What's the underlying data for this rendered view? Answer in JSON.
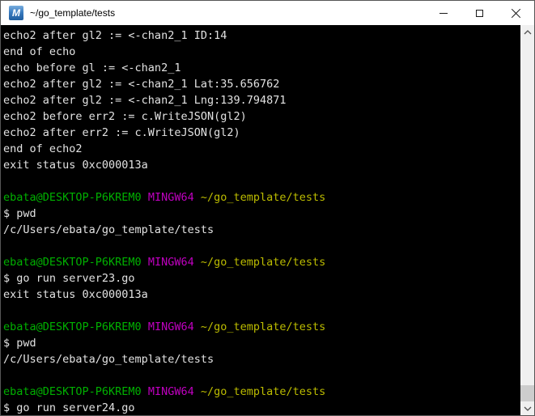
{
  "window": {
    "title": "~/go_template/tests",
    "icon_letter": "M",
    "controls": {
      "minimize": "minimize",
      "maximize": "maximize",
      "close": "close"
    }
  },
  "palette": {
    "background": "#000000",
    "foreground": "#e2e2e2",
    "green": "#00b000",
    "magenta": "#c000c0",
    "yellow": "#bcbc00",
    "titlebar_bg": "#ffffff",
    "titlebar_fg": "#000000",
    "scrollbar_track": "#f0f0f0",
    "scrollbar_thumb": "#cdcdcd"
  },
  "terminal": {
    "lines": [
      [
        [
          "fg",
          "echo2 after gl2 := <-chan2_1 ID:14"
        ]
      ],
      [
        [
          "fg",
          "end of echo"
        ]
      ],
      [
        [
          "fg",
          "echo before gl := <-chan2_1"
        ]
      ],
      [
        [
          "fg",
          "echo2 after gl2 := <-chan2_1 Lat:35.656762"
        ]
      ],
      [
        [
          "fg",
          "echo2 after gl2 := <-chan2_1 Lng:139.794871"
        ]
      ],
      [
        [
          "fg",
          "echo2 before err2 := c.WriteJSON(gl2)"
        ]
      ],
      [
        [
          "fg",
          "echo2 after err2 := c.WriteJSON(gl2)"
        ]
      ],
      [
        [
          "fg",
          "end of echo2"
        ]
      ],
      [
        [
          "fg",
          "exit status 0xc000013a"
        ]
      ],
      [],
      [
        [
          "green",
          "ebata@DESKTOP-P6KREM0"
        ],
        [
          "fg",
          " "
        ],
        [
          "magenta",
          "MINGW64"
        ],
        [
          "fg",
          " "
        ],
        [
          "yellow",
          "~/go_template/tests"
        ]
      ],
      [
        [
          "fg",
          "$ pwd"
        ]
      ],
      [
        [
          "fg",
          "/c/Users/ebata/go_template/tests"
        ]
      ],
      [],
      [
        [
          "green",
          "ebata@DESKTOP-P6KREM0"
        ],
        [
          "fg",
          " "
        ],
        [
          "magenta",
          "MINGW64"
        ],
        [
          "fg",
          " "
        ],
        [
          "yellow",
          "~/go_template/tests"
        ]
      ],
      [
        [
          "fg",
          "$ go run server23.go"
        ]
      ],
      [
        [
          "fg",
          "exit status 0xc000013a"
        ]
      ],
      [],
      [
        [
          "green",
          "ebata@DESKTOP-P6KREM0"
        ],
        [
          "fg",
          " "
        ],
        [
          "magenta",
          "MINGW64"
        ],
        [
          "fg",
          " "
        ],
        [
          "yellow",
          "~/go_template/tests"
        ]
      ],
      [
        [
          "fg",
          "$ pwd"
        ]
      ],
      [
        [
          "fg",
          "/c/Users/ebata/go_template/tests"
        ]
      ],
      [],
      [
        [
          "green",
          "ebata@DESKTOP-P6KREM0"
        ],
        [
          "fg",
          " "
        ],
        [
          "magenta",
          "MINGW64"
        ],
        [
          "fg",
          " "
        ],
        [
          "yellow",
          "~/go_template/tests"
        ]
      ],
      [
        [
          "fg",
          "$ go run server24.go"
        ]
      ]
    ]
  }
}
